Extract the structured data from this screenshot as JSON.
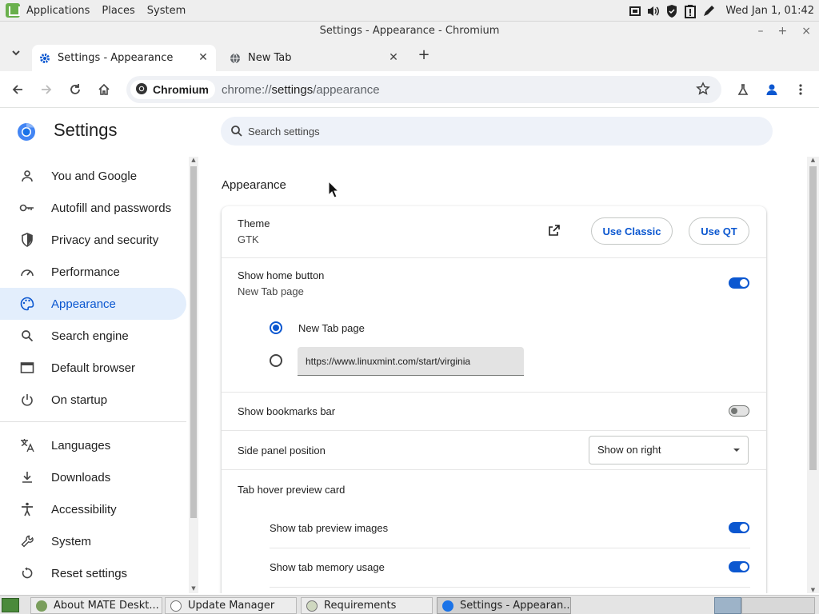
{
  "top_panel": {
    "menus": [
      "Applications",
      "Places",
      "System"
    ],
    "clock": "Wed Jan  1, 01:42"
  },
  "window": {
    "title": "Settings - Appearance - Chromium"
  },
  "tabs": [
    {
      "label": "Settings - Appearance",
      "active": true
    },
    {
      "label": "New Tab",
      "active": false
    }
  ],
  "omnibox": {
    "chip": "Chromium",
    "url_scheme": "chrome://",
    "url_host": "settings",
    "url_path": "/appearance"
  },
  "settings": {
    "title": "Settings",
    "search_placeholder": "Search settings"
  },
  "sidebar": {
    "items": [
      {
        "label": "You and Google",
        "icon": "person-icon"
      },
      {
        "label": "Autofill and passwords",
        "icon": "key-icon"
      },
      {
        "label": "Privacy and security",
        "icon": "shield-icon"
      },
      {
        "label": "Performance",
        "icon": "speedometer-icon"
      },
      {
        "label": "Appearance",
        "icon": "palette-icon",
        "selected": true
      },
      {
        "label": "Search engine",
        "icon": "search-icon"
      },
      {
        "label": "Default browser",
        "icon": "browser-window-icon"
      },
      {
        "label": "On startup",
        "icon": "power-icon"
      },
      {
        "label": "Languages",
        "icon": "translate-icon"
      },
      {
        "label": "Downloads",
        "icon": "download-icon"
      },
      {
        "label": "Accessibility",
        "icon": "accessibility-icon"
      },
      {
        "label": "System",
        "icon": "wrench-icon"
      },
      {
        "label": "Reset settings",
        "icon": "reset-icon"
      }
    ]
  },
  "appearance": {
    "section_title": "Appearance",
    "theme": {
      "label": "Theme",
      "value": "GTK",
      "btn_classic": "Use Classic",
      "btn_qt": "Use QT"
    },
    "home_button": {
      "label": "Show home button",
      "sub": "New Tab page",
      "enabled": true
    },
    "home_options": {
      "new_tab": "New Tab page",
      "custom_url": "https://www.linuxmint.com/start/virginia",
      "selected": "new_tab"
    },
    "bookmarks_bar": {
      "label": "Show bookmarks bar",
      "enabled": false
    },
    "side_panel": {
      "label": "Side panel position",
      "value": "Show on right"
    },
    "hover_card": {
      "label": "Tab hover preview card"
    },
    "preview_images": {
      "label": "Show tab preview images",
      "enabled": true
    },
    "memory_usage": {
      "label": "Show tab memory usage",
      "enabled": true
    }
  },
  "taskbar": {
    "tasks": [
      {
        "label": "About MATE Deskt..."
      },
      {
        "label": "Update Manager"
      },
      {
        "label": "Requirements"
      },
      {
        "label": "Settings - Appearan...",
        "active": true
      }
    ]
  },
  "colors": {
    "accent": "#0b57d0",
    "selected_bg": "#e3eefc"
  }
}
